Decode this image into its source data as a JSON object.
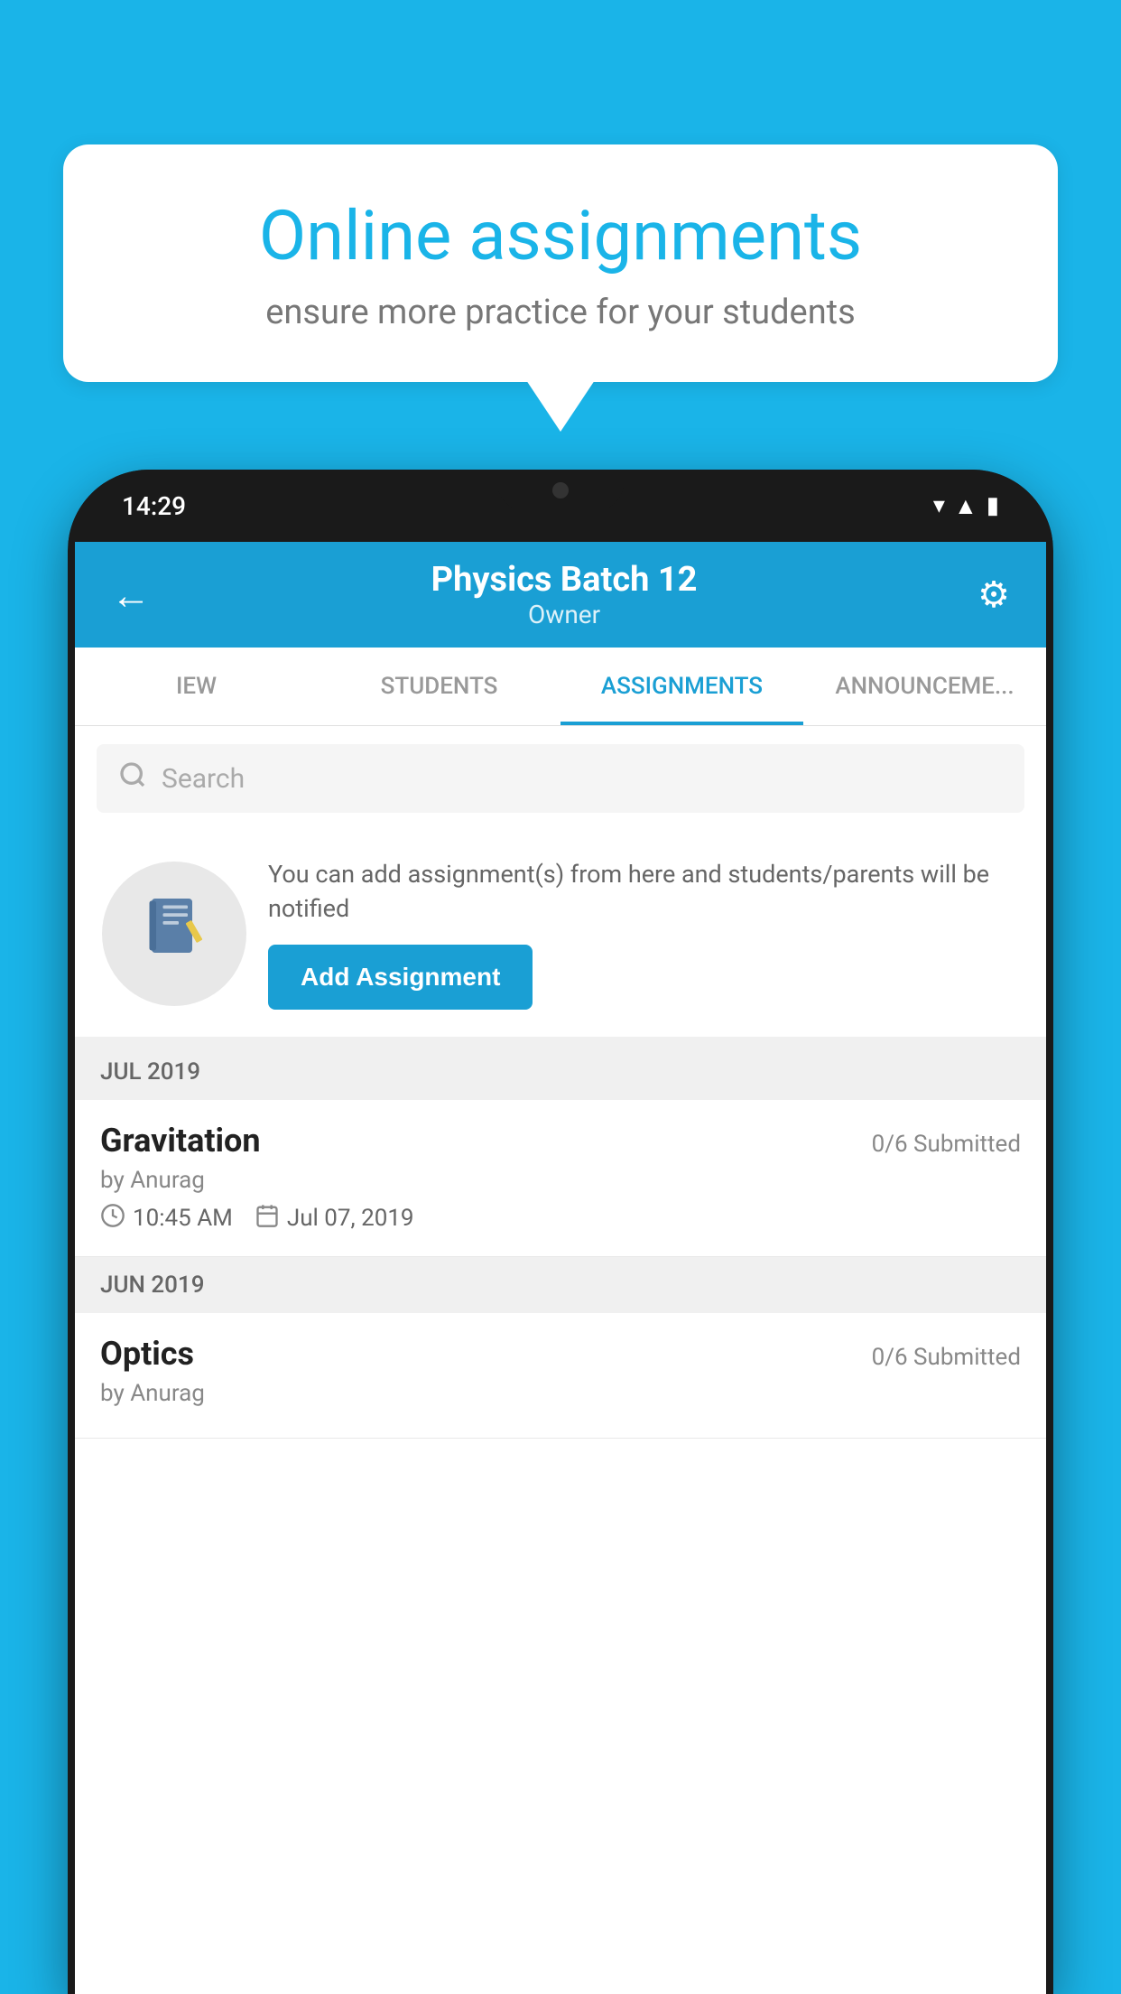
{
  "background_color": "#1ab4e8",
  "speech_bubble": {
    "title": "Online assignments",
    "subtitle": "ensure more practice for your students"
  },
  "phone": {
    "time": "14:29",
    "header": {
      "title": "Physics Batch 12",
      "subtitle": "Owner",
      "back_label": "←",
      "settings_label": "⚙"
    },
    "tabs": [
      {
        "label": "IEW",
        "active": false
      },
      {
        "label": "STUDENTS",
        "active": false
      },
      {
        "label": "ASSIGNMENTS",
        "active": true
      },
      {
        "label": "ANNOUNCEMENTS",
        "active": false
      }
    ],
    "search": {
      "placeholder": "Search"
    },
    "promo": {
      "text": "You can add assignment(s) from here and students/parents will be notified",
      "button_label": "Add Assignment"
    },
    "sections": [
      {
        "header": "JUL 2019",
        "assignments": [
          {
            "name": "Gravitation",
            "submitted": "0/6 Submitted",
            "by": "by Anurag",
            "time": "10:45 AM",
            "date": "Jul 07, 2019"
          }
        ]
      },
      {
        "header": "JUN 2019",
        "assignments": [
          {
            "name": "Optics",
            "submitted": "0/6 Submitted",
            "by": "by Anurag",
            "time": "",
            "date": ""
          }
        ]
      }
    ]
  }
}
